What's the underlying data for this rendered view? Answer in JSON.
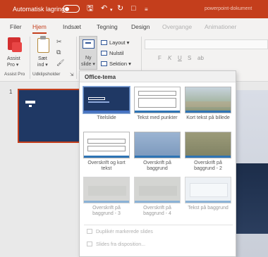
{
  "titlebar": {
    "autosave_label": "Automatisk lagring",
    "filename": "powerpoint-dokument",
    "icons": [
      "save-icon",
      "undo-icon",
      "redo-icon",
      "present-icon",
      "customize-icon"
    ]
  },
  "tabs": [
    {
      "label": "Filer",
      "state": "normal"
    },
    {
      "label": "Hjem",
      "state": "active"
    },
    {
      "label": "Indsæt",
      "state": "normal"
    },
    {
      "label": "Tegning",
      "state": "normal"
    },
    {
      "label": "Design",
      "state": "normal"
    },
    {
      "label": "Overgange",
      "state": "dim"
    },
    {
      "label": "Animationer",
      "state": "dim"
    }
  ],
  "ribbon": {
    "assist_line1": "Assist",
    "assist_line2": "Pro ▾",
    "paste_line1": "Sæt",
    "paste_line2": "ind ▾",
    "newslide_line1": "Ny",
    "newslide_line2": "slide ▾",
    "layout_label": "Layout ▾",
    "reset_label": "Nulstil",
    "section_label": "Sektion ▾",
    "group_assist": "Assist Pro",
    "group_clipboard": "Udklipsholder",
    "format_letters": [
      "F",
      "K",
      "U",
      "S",
      "ab"
    ]
  },
  "thumbnail": {
    "number": "1"
  },
  "dropdown": {
    "header": "Office-tema",
    "layouts": [
      {
        "caption": "Titelslide"
      },
      {
        "caption": "Tekst med punkter"
      },
      {
        "caption": "Kort tekst på billede"
      },
      {
        "caption": "Overskrift og kort tekst"
      },
      {
        "caption": "Overskrift på baggrund"
      },
      {
        "caption": "Overskrift på baggrund - 2"
      },
      {
        "caption": "Overskrift på baggrund - 3"
      },
      {
        "caption": "Overskrift på baggrund - 4"
      },
      {
        "caption": "Tekst på baggrund"
      }
    ],
    "actions": [
      {
        "label": "Duplikér markerede slides"
      },
      {
        "label": "Slides fra disposition..."
      }
    ]
  },
  "colors": {
    "brand": "#c43e1c",
    "slide_dark": "#1f3864",
    "accent_blue": "#2e74b5"
  }
}
